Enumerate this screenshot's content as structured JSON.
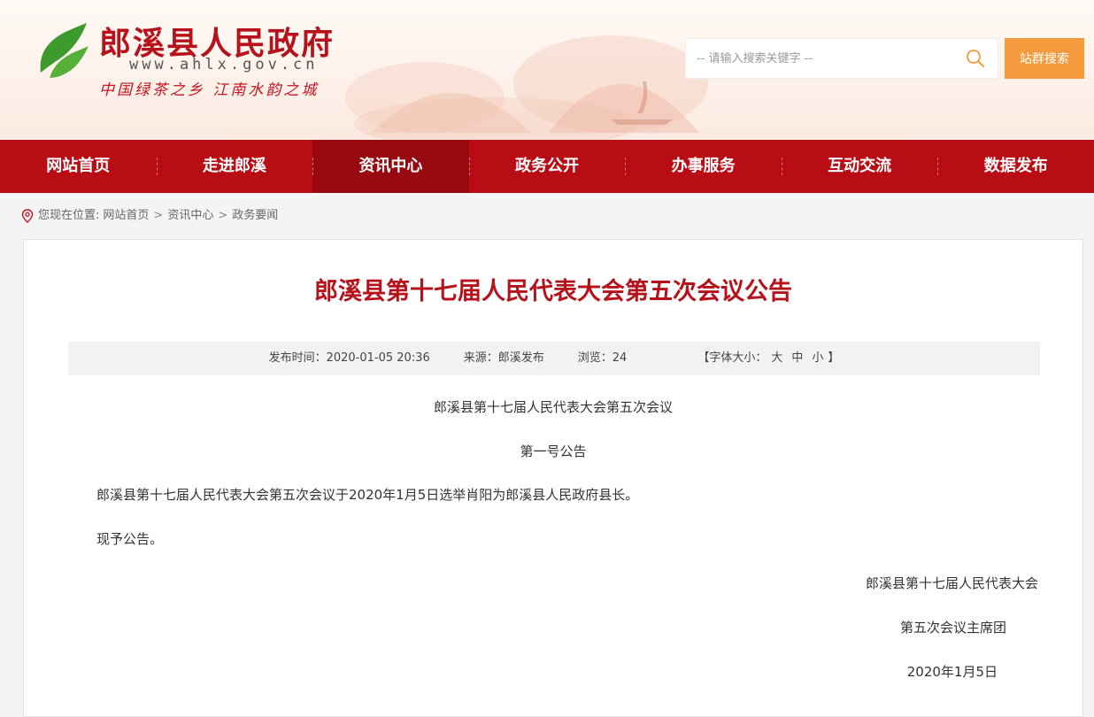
{
  "header": {
    "title": "郎溪县人民政府",
    "url": "www.ahlx.gov.cn",
    "slogan": "中国绿茶之乡 江南水韵之城",
    "search_placeholder": "-- 请输入搜索关键字 --",
    "site_search_label": "站群搜索"
  },
  "nav": {
    "items": [
      "网站首页",
      "走进郎溪",
      "资讯中心",
      "政务公开",
      "办事服务",
      "互动交流",
      "数据发布"
    ],
    "active": "资讯中心"
  },
  "breadcrumb": {
    "prefix": "您现在位置:",
    "items": [
      "网站首页",
      "资讯中心",
      "政务要闻"
    ],
    "separator": ">"
  },
  "article": {
    "title": "郎溪县第十七届人民代表大会第五次会议公告",
    "meta": {
      "publish_time": "发布时间：2020-01-05 20:36",
      "source": "来源：郎溪发布",
      "views": "浏览：24",
      "font_label_open": "【字体大小：",
      "font_sizes": [
        "大",
        "中",
        "小"
      ],
      "font_label_close": "】"
    },
    "body": {
      "heading1": "郎溪县第十七届人民代表大会第五次会议",
      "heading2": "第一号公告",
      "para1": "郎溪县第十七届人民代表大会第五次会议于2020年1月5日选举肖阳为郎溪县人民政府县长。",
      "para2": "现予公告。",
      "sign1": "郎溪县第十七届人民代表大会",
      "sign2": "第五次会议主席团",
      "date": "2020年1月5日"
    }
  },
  "colors": {
    "brand_red": "#b80d15",
    "title_red": "#b5121b",
    "nav_active": "#980a10",
    "search_button": "#f49a3c",
    "logo_green": "#3e9a2c"
  }
}
